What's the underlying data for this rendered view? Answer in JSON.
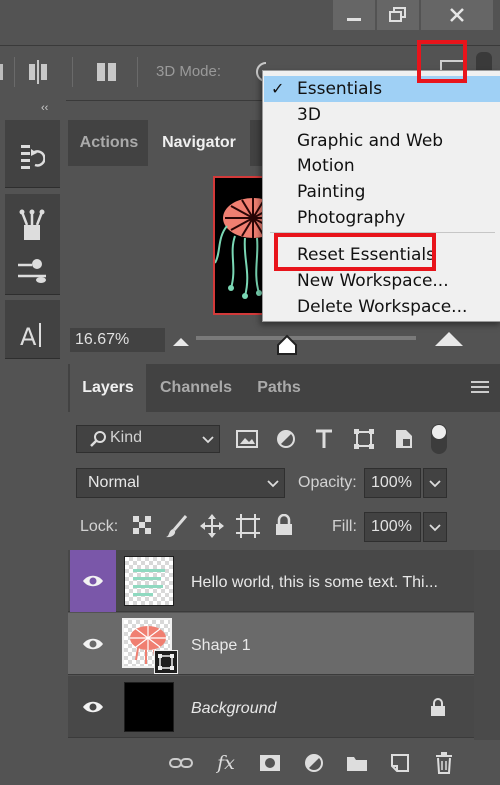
{
  "options_bar": {
    "mode_3d_label": "3D Mode:"
  },
  "navigator": {
    "tabs": [
      {
        "label": "Actions"
      },
      {
        "label": "Navigator"
      }
    ],
    "zoom": "16.67%"
  },
  "workspace_menu": {
    "items": [
      {
        "label": "Essentials",
        "checked": true
      },
      {
        "label": "3D"
      },
      {
        "label": "Graphic and Web"
      },
      {
        "label": "Motion"
      },
      {
        "label": "Painting"
      },
      {
        "label": "Photography"
      },
      {
        "label": "Reset Essentials"
      },
      {
        "label": "New Workspace..."
      },
      {
        "label": "Delete Workspace..."
      }
    ],
    "checkmark": "✓"
  },
  "layers_panel": {
    "tabs": [
      {
        "label": "Layers"
      },
      {
        "label": "Channels"
      },
      {
        "label": "Paths"
      }
    ],
    "filter_kind": "Kind",
    "blend_mode": "Normal",
    "opacity_label": "Opacity:",
    "opacity_value": "100%",
    "lock_label": "Lock:",
    "fill_label": "Fill:",
    "fill_value": "100%",
    "layers": [
      {
        "name": "Hello world, this is some text. Thi..."
      },
      {
        "name": "Shape 1"
      },
      {
        "name": "Background"
      }
    ],
    "fx_label": "fx"
  },
  "colors": {
    "highlight_red": "#e8141b",
    "selected_layer": "#7a57a9",
    "menu_selection": "#9fd0f5"
  }
}
